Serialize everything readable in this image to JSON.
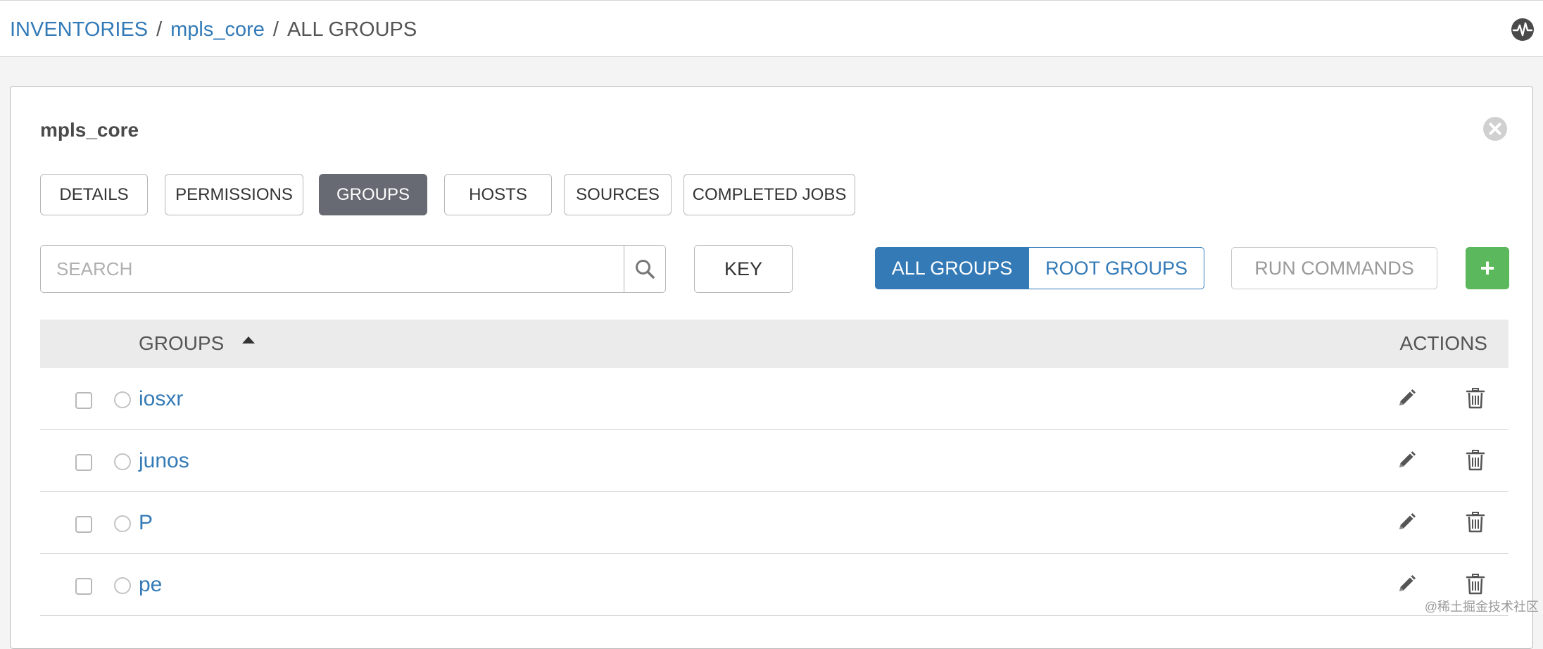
{
  "breadcrumb": {
    "items": [
      "INVENTORIES",
      "mpls_core",
      "ALL GROUPS"
    ],
    "separator": "/"
  },
  "header": {
    "activity_icon": "activity-stream-icon"
  },
  "panel": {
    "title": "mpls_core",
    "close_icon": "close-icon"
  },
  "tabs": [
    {
      "label": "DETAILS",
      "active": false
    },
    {
      "label": "PERMISSIONS",
      "active": false
    },
    {
      "label": "GROUPS",
      "active": true
    },
    {
      "label": "HOSTS",
      "active": false
    },
    {
      "label": "SOURCES",
      "active": false
    },
    {
      "label": "COMPLETED JOBS",
      "active": false
    }
  ],
  "search": {
    "placeholder": "SEARCH",
    "value": ""
  },
  "key_button": "KEY",
  "group_filter": {
    "all_label": "ALL GROUPS",
    "root_label": "ROOT GROUPS",
    "selected": "ALL GROUPS"
  },
  "run_commands_label": "RUN COMMANDS",
  "add_label": "+",
  "table": {
    "columns": {
      "groups": "GROUPS",
      "actions": "ACTIONS"
    },
    "sort": "ascending",
    "rows": [
      {
        "name": "iosxr"
      },
      {
        "name": "junos"
      },
      {
        "name": "P"
      },
      {
        "name": "pe"
      }
    ]
  },
  "watermark": "@稀土掘金技术社区",
  "colors": {
    "link": "#337ab7",
    "active_tab": "#676a72",
    "primary": "#337ab7",
    "success": "#5cb85c",
    "header_bg": "#ebebeb"
  }
}
